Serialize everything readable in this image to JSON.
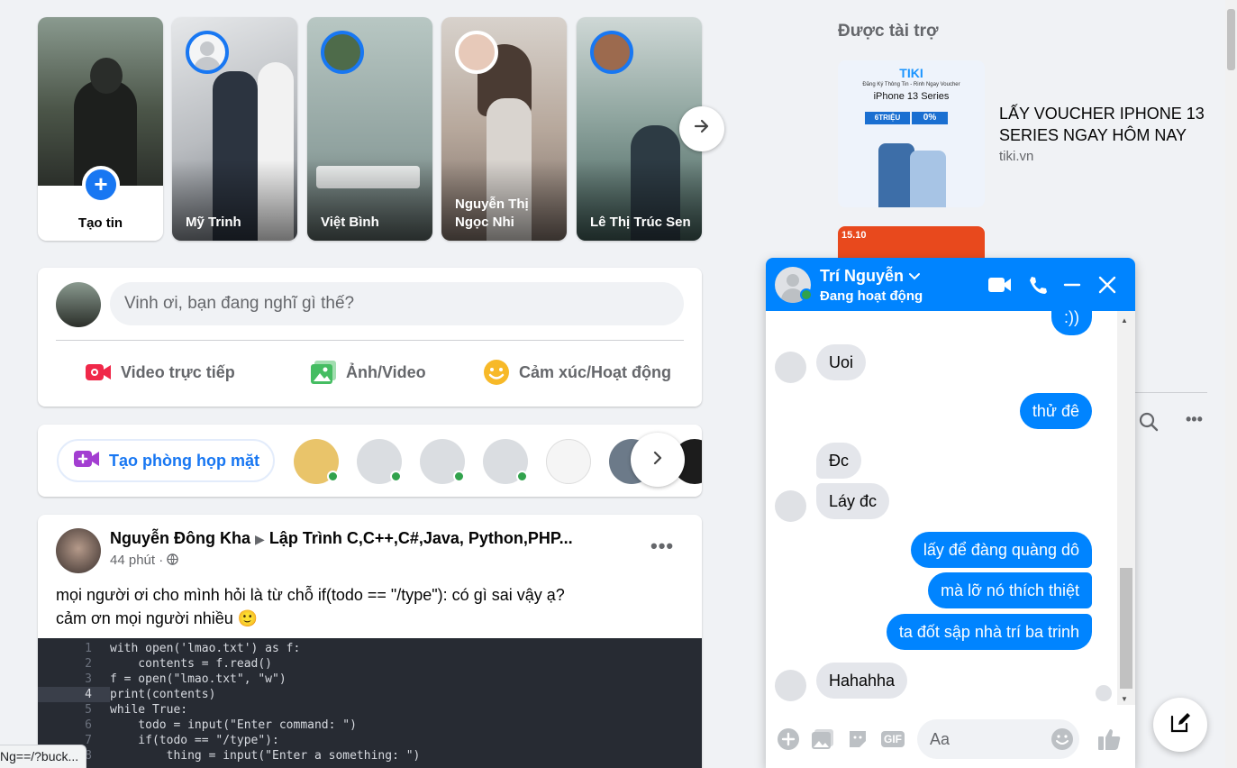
{
  "stories": {
    "create_label": "Tạo tin",
    "items": [
      {
        "name": "Mỹ Trinh"
      },
      {
        "name": "Việt Bình"
      },
      {
        "name": "Nguyễn Thị Ngọc Nhi"
      },
      {
        "name": "Lê Thị Trúc Sen"
      }
    ]
  },
  "composer": {
    "placeholder": "Vinh ơi, bạn đang nghĩ gì thế?",
    "actions": [
      {
        "label": "Video trực tiếp",
        "color": "#f02849"
      },
      {
        "label": "Ảnh/Video",
        "color": "#45bd62"
      },
      {
        "label": "Cảm xúc/Hoạt động",
        "color": "#f7b928"
      }
    ]
  },
  "rooms": {
    "create_label": "Tạo phòng họp mặt"
  },
  "post": {
    "author": "Nguyễn Đông Kha",
    "group": "Lập Trình C,C++,C#,Java, Python,PHP...",
    "time": "44 phút ·",
    "text_line1": "mọi người ơi cho mình hỏi là từ chỗ if(todo == \"/type\"): có gì sai vậy ạ?",
    "text_line2": "cảm ơn mọi người nhiều 🙂",
    "code_lines": [
      {
        "num": "1",
        "code": "with open('lmao.txt') as f:"
      },
      {
        "num": "2",
        "code": "    contents = f.read()"
      },
      {
        "num": "3",
        "code": "f = open(\"lmao.txt\", \"w\")"
      },
      {
        "num": "4",
        "code": "print(contents)"
      },
      {
        "num": "5",
        "code": "while True:"
      },
      {
        "num": "6",
        "code": "    todo = input(\"Enter command: \")"
      },
      {
        "num": "7",
        "code": "    if(todo == \"/type\"):"
      },
      {
        "num": "8",
        "code": "        thing = input(\"Enter a something: \")"
      }
    ]
  },
  "sponsored": {
    "title": "Được tài trợ",
    "ad_title": "LẤY VOUCHER IPHONE 13 SERIES NGAY HÔM NAY",
    "ad_domain": "tiki.vn",
    "ad_image_brand": "TIKI",
    "ad_image_line1": "Đăng Ký Thông Tin - Rinh Ngay Voucher",
    "ad_image_product": "iPhone 13 Series",
    "ad_image_offer1": "6TRIỆU",
    "ad_image_offer2": "0%",
    "ad2_label": "15.10"
  },
  "chat": {
    "name": "Trí Nguyễn",
    "status": "Đang hoạt động",
    "input_placeholder": "Aa",
    "messages": [
      {
        "dir": "out",
        "text": ":))"
      },
      {
        "dir": "in",
        "text": "Uoi"
      },
      {
        "dir": "out",
        "text": "thử đê"
      },
      {
        "dir": "in",
        "text": "Đc"
      },
      {
        "dir": "in",
        "text": "Láy đc"
      },
      {
        "dir": "out",
        "text": "lấy để đàng quàng dô"
      },
      {
        "dir": "out",
        "text": "mà lỡ nó thích thiệt"
      },
      {
        "dir": "out",
        "text": "ta đốt sập nhà trí ba trinh"
      },
      {
        "dir": "in",
        "text": "Hahahha"
      }
    ],
    "gif_label": "GIF"
  },
  "status_url": "Ng==/?buck...",
  "colors": {
    "accent": "#1877f2",
    "messenger": "#0084ff",
    "online": "#31a24c"
  }
}
